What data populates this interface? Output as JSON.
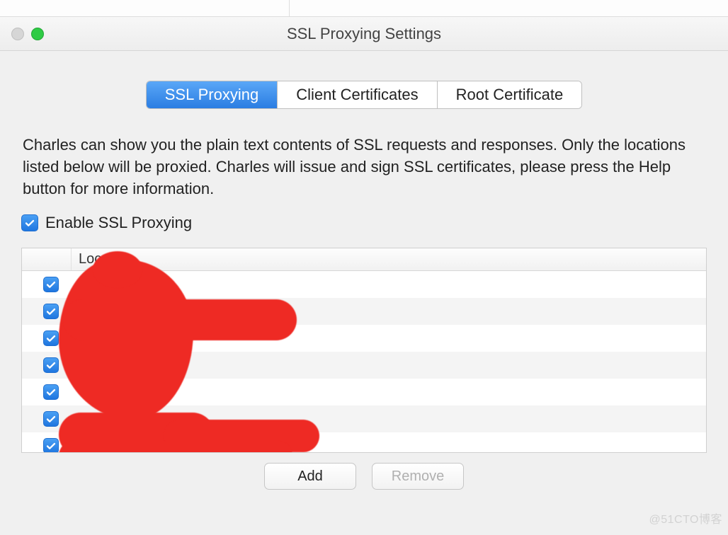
{
  "window": {
    "title": "SSL Proxying Settings"
  },
  "tabs": {
    "ssl_proxying": "SSL Proxying",
    "client_certificates": "Client Certificates",
    "root_certificate": "Root Certificate"
  },
  "description": "Charles can show you the plain text contents of SSL requests and responses. Only the locations listed below will be proxied. Charles will issue and sign SSL certificates, please press the Help button for more information.",
  "enable_checkbox": {
    "label": "Enable SSL Proxying",
    "checked": true
  },
  "table": {
    "header_location": "Location",
    "rows": [
      {
        "checked": true,
        "location": ""
      },
      {
        "checked": true,
        "location": ""
      },
      {
        "checked": true,
        "location": ""
      },
      {
        "checked": true,
        "location": ""
      },
      {
        "checked": true,
        "location": ""
      },
      {
        "checked": true,
        "location": ""
      },
      {
        "checked": true,
        "location": ""
      }
    ]
  },
  "buttons": {
    "add": "Add",
    "remove": "Remove"
  },
  "watermark": "@51CTO博客"
}
